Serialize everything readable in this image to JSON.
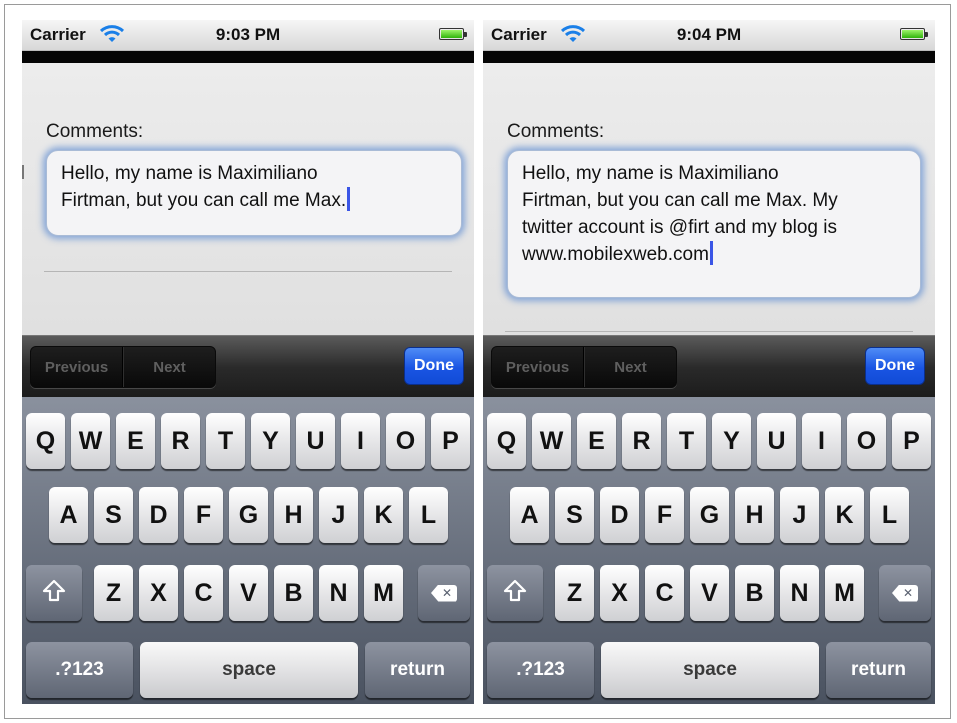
{
  "phones": [
    {
      "status": {
        "carrier": "Carrier",
        "time": "9:03 PM"
      },
      "form": {
        "label": "Comments:",
        "lines": [
          "Hello, my name is Maximiliano",
          "Firtman, but you can call me Max."
        ]
      },
      "toolbar": {
        "previous": "Previous",
        "next": "Next",
        "done": "Done"
      }
    },
    {
      "status": {
        "carrier": "Carrier",
        "time": "9:04 PM"
      },
      "form": {
        "label": "Comments:",
        "lines": [
          "Hello, my name is Maximiliano",
          "Firtman, but you can call me Max. My",
          "twitter account is @firt and my blog is",
          "www.mobilexweb.com"
        ]
      },
      "toolbar": {
        "previous": "Previous",
        "next": "Next",
        "done": "Done"
      }
    }
  ],
  "keyboard": {
    "row1": [
      "Q",
      "W",
      "E",
      "R",
      "T",
      "Y",
      "U",
      "I",
      "O",
      "P"
    ],
    "row2": [
      "A",
      "S",
      "D",
      "F",
      "G",
      "H",
      "J",
      "K",
      "L"
    ],
    "row3": [
      "Z",
      "X",
      "C",
      "V",
      "B",
      "N",
      "M"
    ],
    "numbers_key": ".?123",
    "space_key": "space",
    "return_key": "return",
    "shift_icon": "shift-arrow-icon",
    "delete_icon": "backspace-icon"
  },
  "colors": {
    "done_button": "#1a55e3",
    "focus_glow": "#5e8cd2",
    "caret": "#3a55e6",
    "battery": "#2fb30b"
  }
}
